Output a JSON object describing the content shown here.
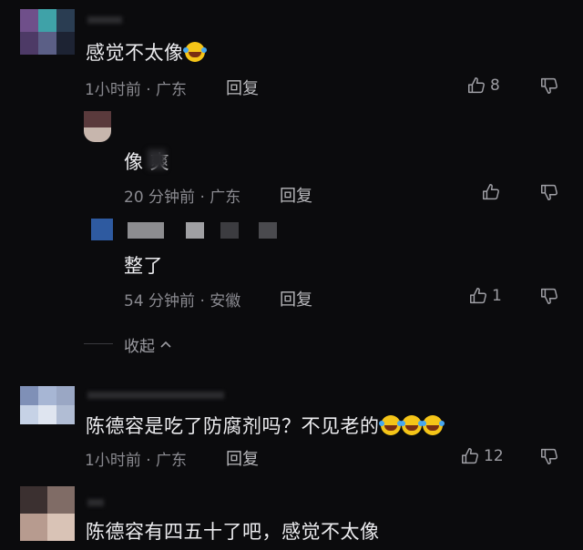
{
  "comments": [
    {
      "text": "感觉不太像",
      "emoji_count": 1,
      "meta": "1小时前 · 广东",
      "reply_label": "回复",
      "likes": "8"
    },
    {
      "text": "像    爽",
      "meta": "20 分钟前 · 广东",
      "reply_label": "回复",
      "likes": ""
    },
    {
      "text": "整了",
      "meta": "54 分钟前 · 安徽",
      "reply_label": "回复",
      "likes": "1"
    },
    {
      "text": "陈德容是吃了防腐剂吗？不见老的",
      "emoji_count": 3,
      "meta": "1小时前 · 广东",
      "reply_label": "回复",
      "likes": "12"
    },
    {
      "text": "陈德容有四五十了吧，感觉不太像"
    }
  ],
  "collapse_label": "收起",
  "colors": {
    "background": "#0b0b0d",
    "text": "#ececef",
    "meta": "#8a8a90",
    "emoji": "#f5c518"
  }
}
